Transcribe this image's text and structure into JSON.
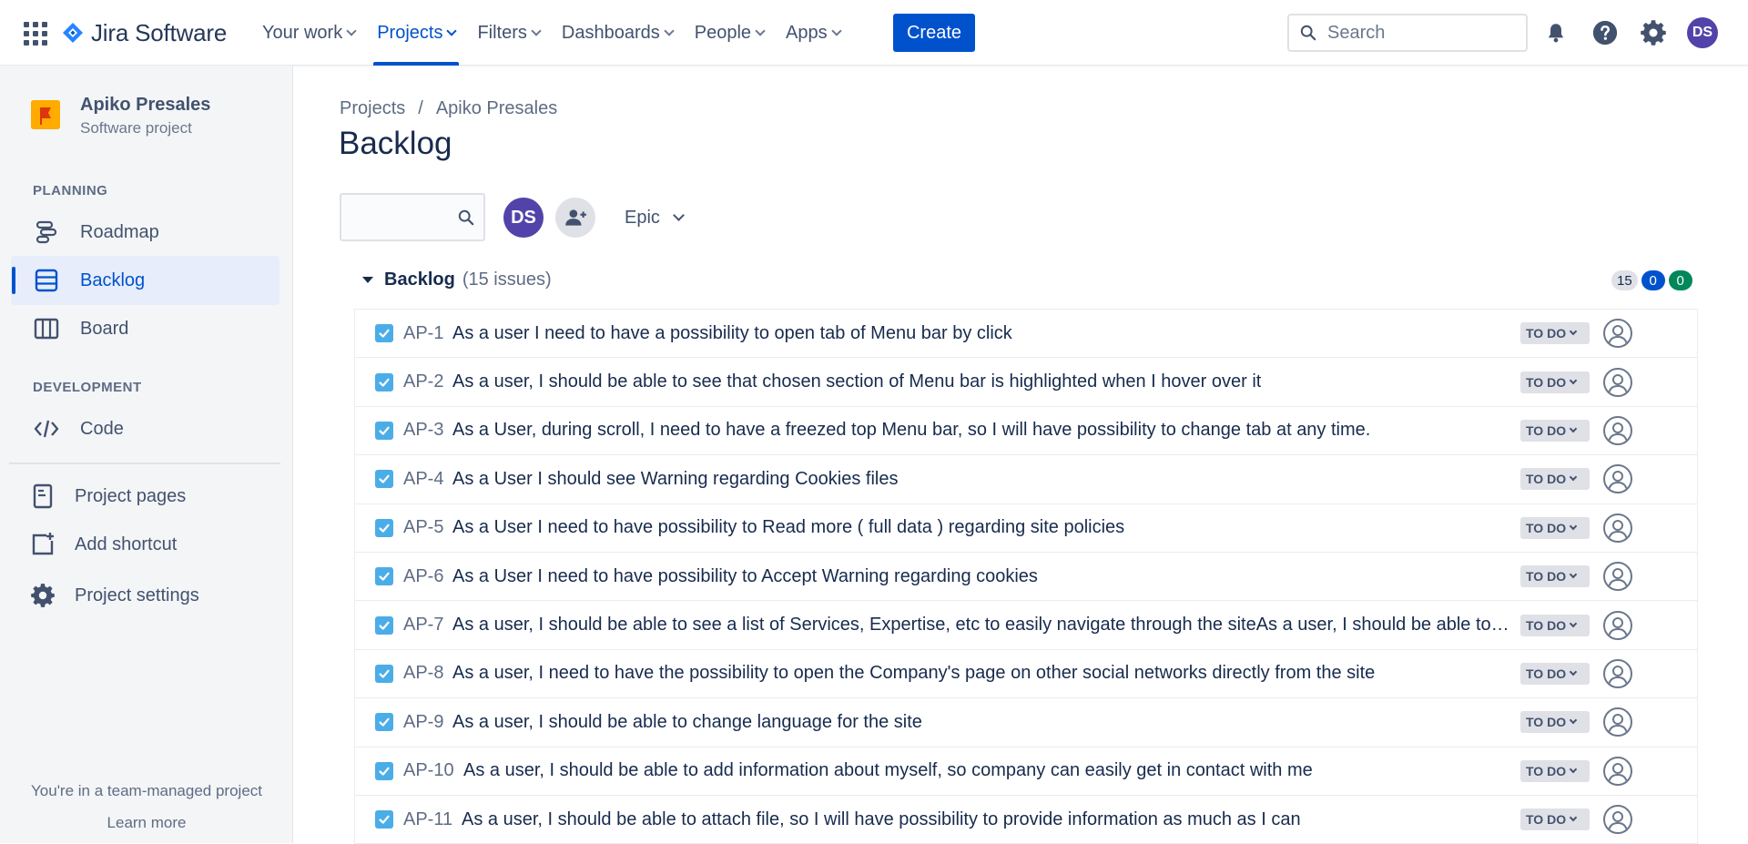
{
  "topnav": {
    "product": "Jira Software",
    "items": [
      {
        "label": "Your work",
        "active": false
      },
      {
        "label": "Projects",
        "active": true
      },
      {
        "label": "Filters",
        "active": false
      },
      {
        "label": "Dashboards",
        "active": false
      },
      {
        "label": "People",
        "active": false
      },
      {
        "label": "Apps",
        "active": false
      }
    ],
    "create_label": "Create",
    "search_placeholder": "Search",
    "user_initials": "DS"
  },
  "sidebar": {
    "project_name": "Apiko Presales",
    "project_type": "Software project",
    "planning_label": "PLANNING",
    "planning_items": [
      {
        "label": "Roadmap",
        "icon": "roadmap-icon"
      },
      {
        "label": "Backlog",
        "icon": "backlog-icon",
        "active": true
      },
      {
        "label": "Board",
        "icon": "board-icon"
      }
    ],
    "development_label": "DEVELOPMENT",
    "development_items": [
      {
        "label": "Code",
        "icon": "code-icon"
      }
    ],
    "extra_items": [
      {
        "label": "Project pages",
        "icon": "page-icon"
      },
      {
        "label": "Add shortcut",
        "icon": "add-shortcut-icon"
      },
      {
        "label": "Project settings",
        "icon": "gear-icon"
      }
    ],
    "team_note": "You're in a team-managed project",
    "learn_more": "Learn more"
  },
  "main": {
    "breadcrumb": [
      "Projects",
      "Apiko Presales"
    ],
    "breadcrumb_sep": "/",
    "title": "Backlog",
    "filter_avatar": "DS",
    "epic_label": "Epic",
    "backlog": {
      "title": "Backlog",
      "count_text": "(15 issues)",
      "badges": {
        "todo": "15",
        "in_progress": "0",
        "done": "0"
      }
    },
    "issues": [
      {
        "key": "AP-1",
        "summary": "As a user I need to have a possibility to open tab of Menu bar by click",
        "status": "TO DO"
      },
      {
        "key": "AP-2",
        "summary": "As a user, I should be able to see that chosen section of Menu bar is highlighted when I hover over it",
        "status": "TO DO"
      },
      {
        "key": "AP-3",
        "summary": "As a User, during scroll, I need to have a freezed top Menu bar, so I will have possibility to change tab at any time.",
        "status": "TO DO"
      },
      {
        "key": "AP-4",
        "summary": "As a User I should see Warning regarding Cookies files",
        "status": "TO DO"
      },
      {
        "key": "AP-5",
        "summary": "As a User I need to have possibility to Read more ( full data ) regarding site policies",
        "status": "TO DO"
      },
      {
        "key": "AP-6",
        "summary": "As a User I need to have possibility to Accept Warning regarding cookies",
        "status": "TO DO"
      },
      {
        "key": "AP-7",
        "summary": "As a user, I should be able to see a list of Services, Expertise, etc to easily navigate through the siteAs a user, I should be able to see a list of Services",
        "status": "TO DO"
      },
      {
        "key": "AP-8",
        "summary": "As a user, I need to have the possibility to open the Company's page on other social networks directly from the site",
        "status": "TO DO"
      },
      {
        "key": "AP-9",
        "summary": "As a user, I should be able to change language for the site",
        "status": "TO DO"
      },
      {
        "key": "AP-10",
        "summary": "As a user, I should be able to add information about myself, so company can easily get in contact with me",
        "status": "TO DO"
      },
      {
        "key": "AP-11",
        "summary": "As a user, I should be able to attach file, so I will have possibility to provide information as much as I can",
        "status": "TO DO"
      }
    ]
  },
  "colors": {
    "brand": "#0052cc",
    "sidebar_bg": "#f4f5f7",
    "story": "#4bade8",
    "done": "#00875a"
  }
}
